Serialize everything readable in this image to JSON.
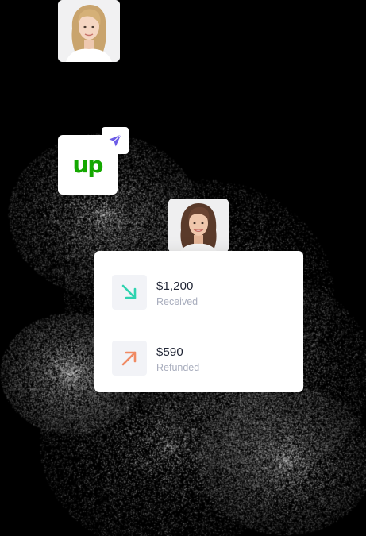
{
  "logo": {
    "text": "up",
    "brand_color": "#14a800",
    "icon": "upwork-logo"
  },
  "badge": {
    "icon": "paper-plane-icon",
    "color": "#6c5ce7"
  },
  "avatars": [
    {
      "icon": "avatar-woman-blonde"
    },
    {
      "icon": "avatar-woman-brunette"
    }
  ],
  "payments": {
    "received": {
      "amount": "$1,200",
      "label": "Received",
      "icon": "arrow-down-right-icon",
      "color": "#2fd3b0"
    },
    "refunded": {
      "amount": "$590",
      "label": "Refunded",
      "icon": "arrow-up-right-icon",
      "color": "#f08a63"
    }
  }
}
